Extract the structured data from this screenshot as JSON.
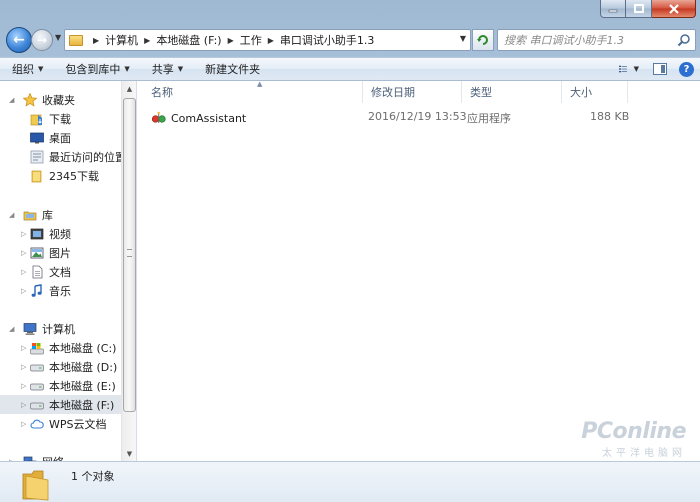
{
  "address": {
    "crumbs": [
      "计算机",
      "本地磁盘 (F:)",
      "工作",
      "串口调试小助手1.3"
    ]
  },
  "search": {
    "placeholder": "搜索 串口调试小助手1.3"
  },
  "toolbar": {
    "organize": "组织",
    "include_library": "包含到库中",
    "share": "共享",
    "new_folder": "新建文件夹"
  },
  "nav": {
    "favorites": "收藏夹",
    "downloads": "下载",
    "desktop": "桌面",
    "recent": "最近访问的位置",
    "downloads2345": "2345下载",
    "libraries": "库",
    "videos": "视频",
    "pictures": "图片",
    "documents": "文档",
    "music": "音乐",
    "computer": "计算机",
    "drive_c": "本地磁盘 (C:)",
    "drive_d": "本地磁盘 (D:)",
    "drive_e": "本地磁盘 (E:)",
    "drive_f": "本地磁盘 (F:)",
    "wps_cloud": "WPS云文档",
    "network": "网络"
  },
  "columns": {
    "name": "名称",
    "date": "修改日期",
    "type": "类型",
    "size": "大小"
  },
  "files": [
    {
      "name": "ComAssistant",
      "date": "2016/12/19 13:53",
      "type": "应用程序",
      "size": "188 KB"
    }
  ],
  "status": {
    "count": "1 个对象"
  },
  "watermark": {
    "main": "PConline",
    "sub": "太平洋电脑网"
  },
  "colors": {
    "accent": "#2c6fd0",
    "selection": "#e1e6ec"
  }
}
